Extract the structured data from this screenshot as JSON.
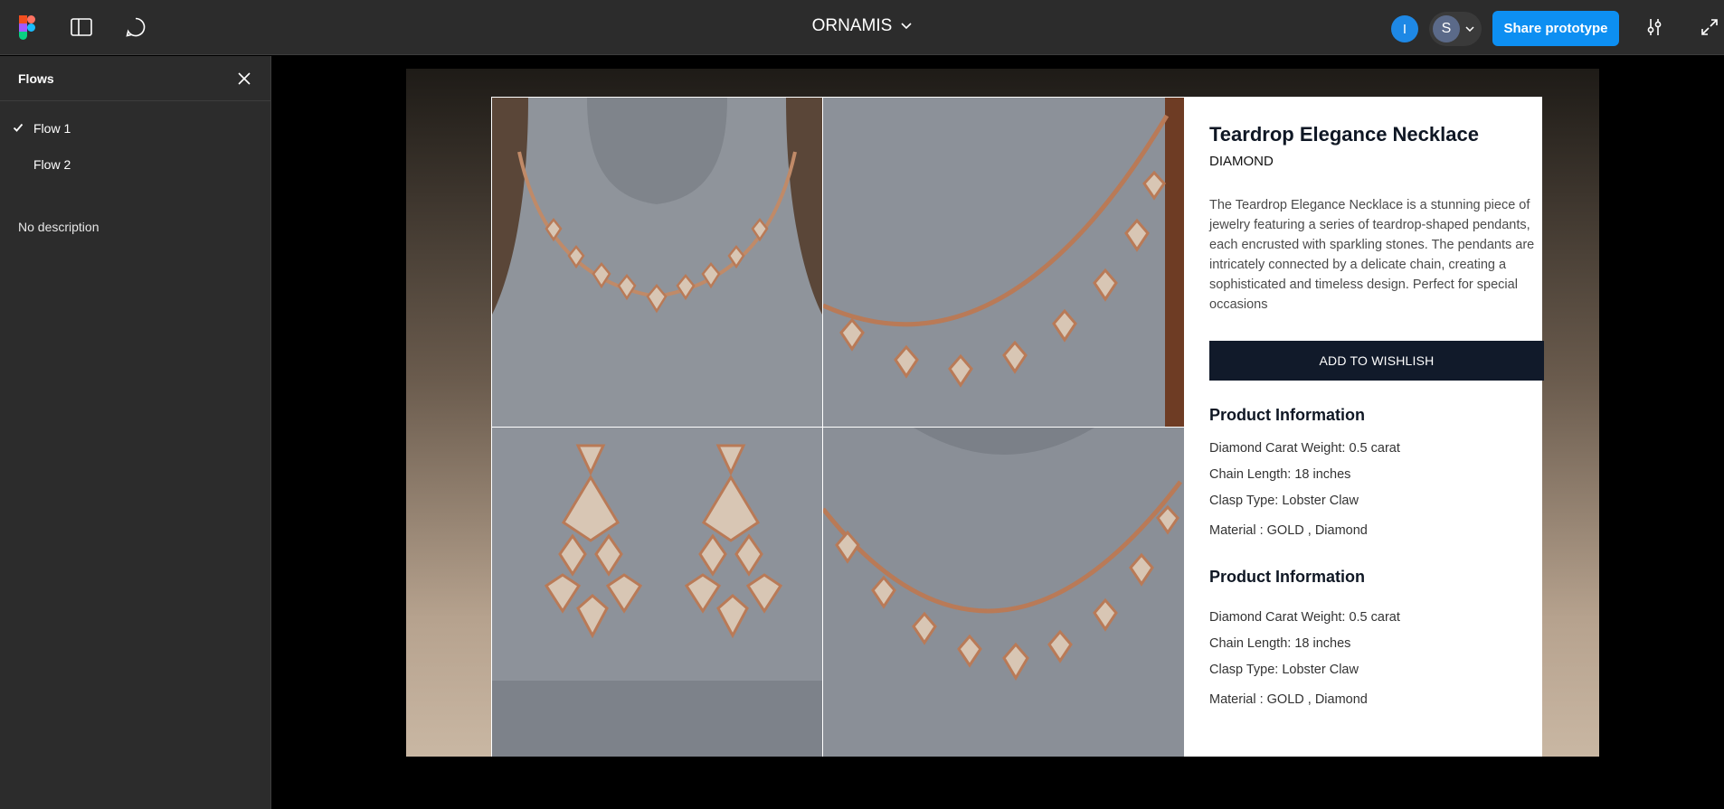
{
  "toolbar": {
    "logo": "figma-logo",
    "icons": [
      "sidebar-toggle-icon",
      "comment-icon"
    ],
    "file_title": "ORNAMIS",
    "avatars": [
      "I",
      "S"
    ],
    "share_label": "Share prototype",
    "right_icons": [
      "settings-sliders-icon",
      "expand-icon"
    ]
  },
  "sidebar": {
    "title": "Flows",
    "flows": [
      {
        "label": "Flow 1",
        "selected": true
      },
      {
        "label": "Flow 2",
        "selected": false
      }
    ],
    "description": "No description"
  },
  "product": {
    "title": "Teardrop Elegance Necklace",
    "category": "DIAMOND",
    "description": "The Teardrop Elegance Necklace is a stunning piece of jewelry featuring a series of teardrop-shaped pendants, each encrusted with sparkling stones. The pendants are intricately connected by a delicate chain, creating a sophisticated and timeless design. Perfect for special occasions",
    "wishlist_label": "ADD TO WISHLISH",
    "info_sections": [
      {
        "heading": "Product Information",
        "lines": [
          "Diamond Carat Weight: 0.5 carat",
          "Chain Length: 18 inches",
          "Clasp Type: Lobster Claw",
          "Material : GOLD , Diamond"
        ]
      },
      {
        "heading": "Product Information",
        "lines": [
          "Diamond Carat Weight: 0.5 carat",
          "Chain Length: 18 inches",
          "Clasp Type: Lobster Claw",
          "Material : GOLD , Diamond"
        ]
      }
    ]
  },
  "colors": {
    "accent": "#0d8ff2",
    "topbar": "#2c2c2c",
    "button_dark": "#111a2a",
    "gold": "#c08a68"
  }
}
